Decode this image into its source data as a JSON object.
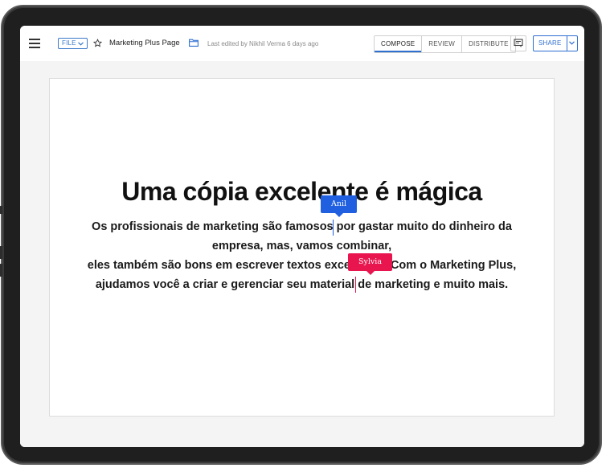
{
  "toolbar": {
    "file_label": "FILE",
    "doc_title": "Marketing Plus Page",
    "last_edited": "Last edited by Nikhil Verma 6 days ago",
    "tabs": [
      {
        "label": "COMPOSE",
        "active": true
      },
      {
        "label": "REVIEW",
        "active": false
      },
      {
        "label": "DISTRIBUTE",
        "active": false
      }
    ],
    "share_label": "SHARE"
  },
  "document": {
    "headline": "Uma cópia excelente é mágica",
    "body_lines": [
      "Os profissionais de marketing são famosos por gastar muito do dinheiro da",
      "empresa, mas, vamos combinar,",
      "eles também são bons em escrever textos excelentes. Com o Marketing Plus,",
      "ajudamos você a criar e gerenciar seu material de marketing e muito mais."
    ]
  },
  "collaborators": [
    {
      "name": "Anil",
      "color": "#1f5fe0"
    },
    {
      "name": "Sylvia",
      "color": "#e8154f"
    }
  ],
  "colors": {
    "accent": "#2f6fd0",
    "canvas_bg": "#f4f4f4",
    "device_frame": "#1f1f1f"
  },
  "icons": [
    "menu-icon",
    "chevron-down-icon",
    "star-icon",
    "folder-icon",
    "comment-icon"
  ]
}
